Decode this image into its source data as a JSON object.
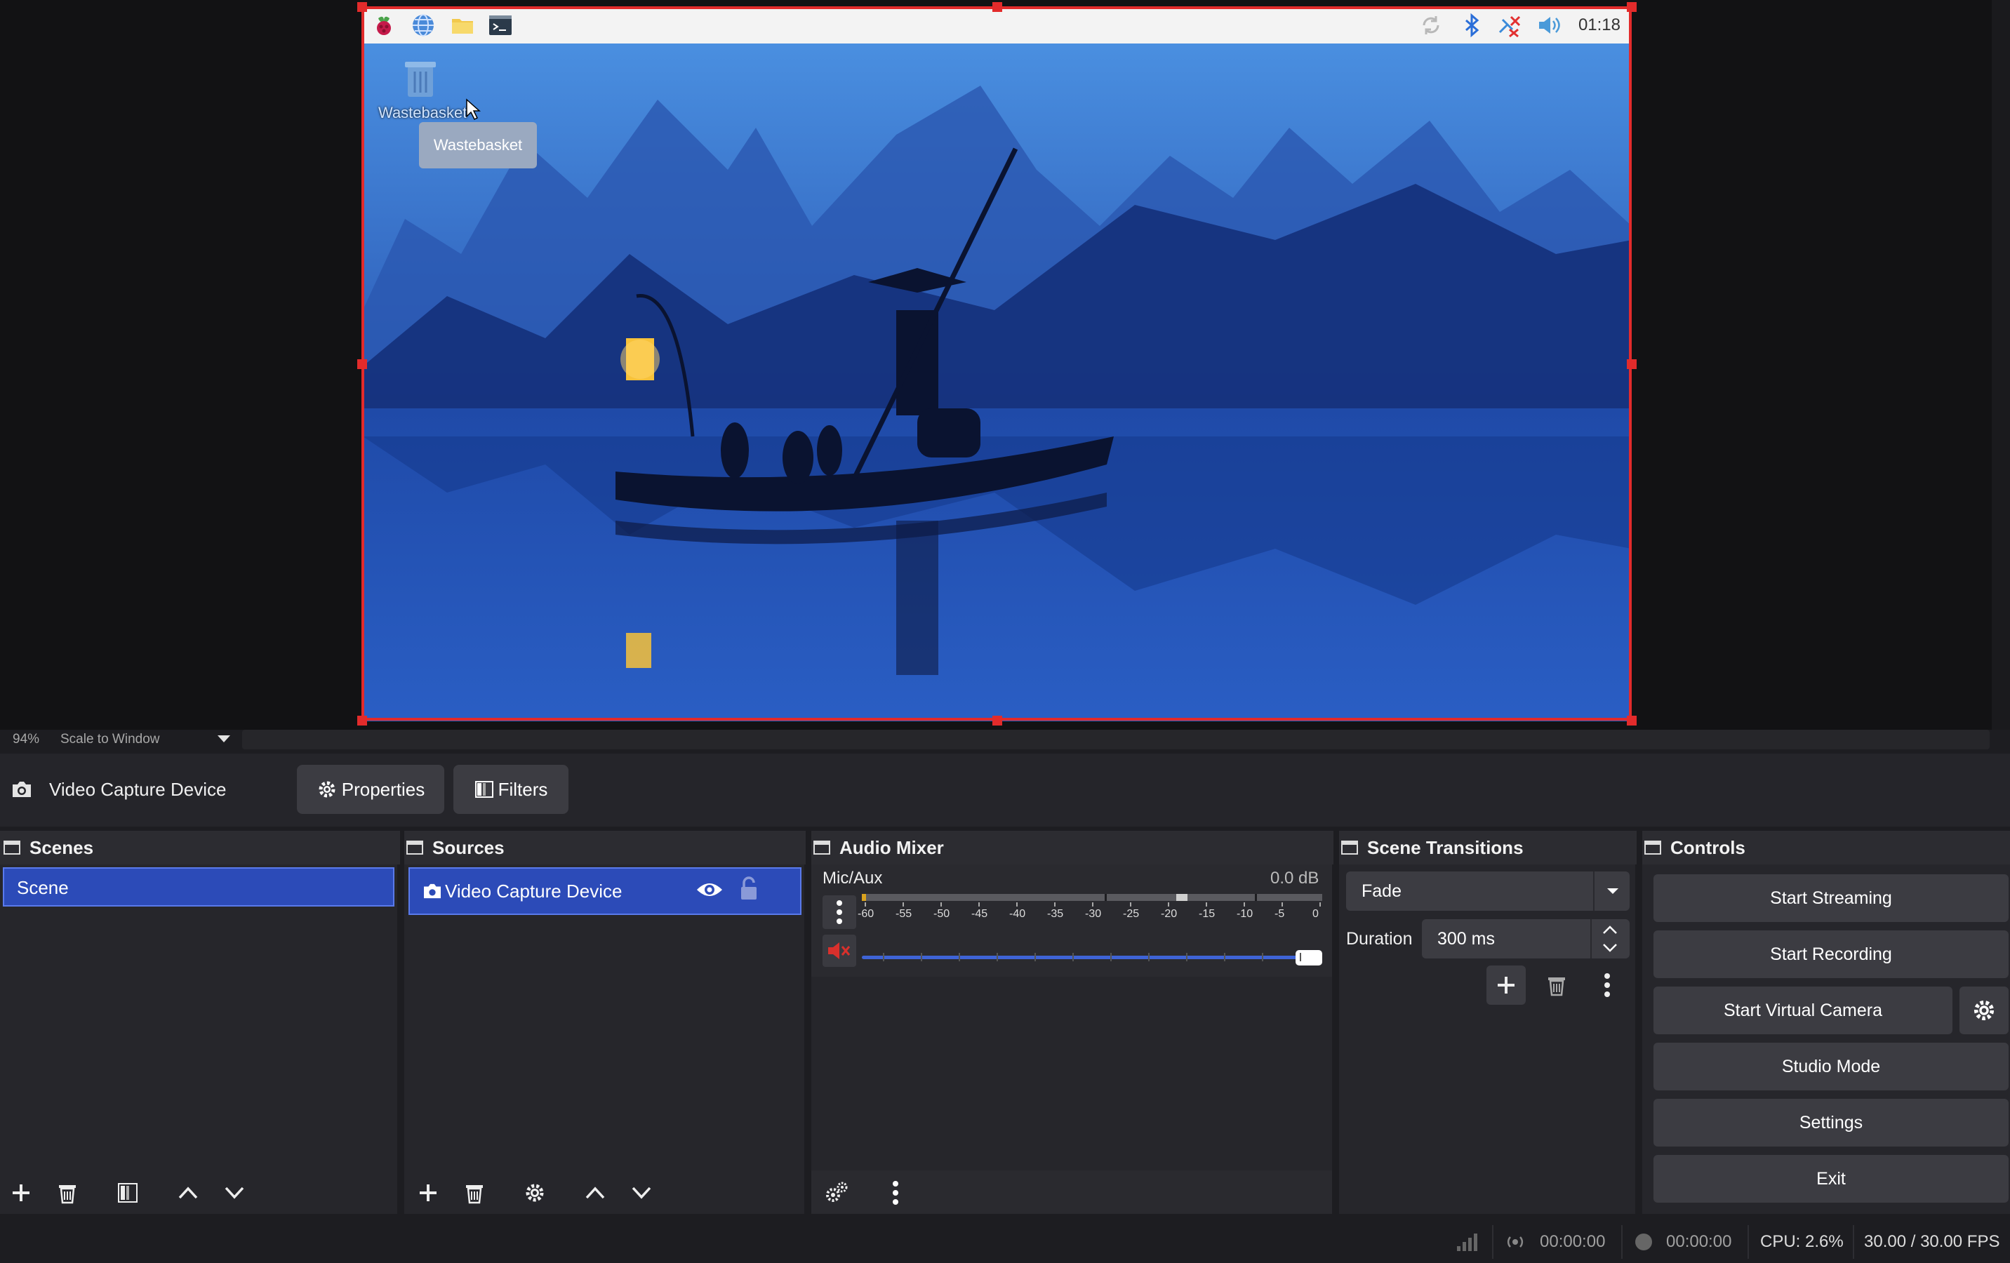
{
  "preview": {
    "taskbar": {
      "clock": "01:18",
      "icons": [
        "raspberry-icon",
        "web-browser-icon",
        "file-manager-icon",
        "terminal-icon",
        "sync-icon",
        "bluetooth-icon",
        "network-disconnected-icon",
        "volume-icon"
      ]
    },
    "desktop": {
      "wastebasket_label": "Wastebasket",
      "tooltip": "Wastebasket"
    }
  },
  "zoom": {
    "percent": "94%",
    "mode": "Scale to Window"
  },
  "context": {
    "source_name": "Video Capture Device",
    "properties_label": "Properties",
    "filters_label": "Filters"
  },
  "scenes": {
    "title": "Scenes",
    "items": [
      "Scene"
    ]
  },
  "sources": {
    "title": "Sources",
    "items": [
      "Video Capture Device"
    ]
  },
  "audio_mixer": {
    "title": "Audio Mixer",
    "channel_name": "Mic/Aux",
    "level": "0.0 dB",
    "meter_ticks": [
      "-60",
      "-55",
      "-50",
      "-45",
      "-40",
      "-35",
      "-30",
      "-25",
      "-20",
      "-15",
      "-10",
      "-5",
      "0"
    ],
    "volume_fraction": 1.0,
    "muted": true
  },
  "transitions": {
    "title": "Scene Transitions",
    "selected": "Fade",
    "duration_label": "Duration",
    "duration_value": "300 ms"
  },
  "controls": {
    "title": "Controls",
    "start_streaming": "Start Streaming",
    "start_recording": "Start Recording",
    "start_virtual_camera": "Start Virtual Camera",
    "studio_mode": "Studio Mode",
    "settings": "Settings",
    "exit": "Exit"
  },
  "status": {
    "stream_time": "00:00:00",
    "record_time": "00:00:00",
    "cpu": "CPU: 2.6%",
    "fps": "30.00 / 30.00 FPS"
  },
  "colors": {
    "selection": "#e22b2b",
    "selected_item": "#2c4bb8",
    "mute_red": "#d9302c"
  }
}
